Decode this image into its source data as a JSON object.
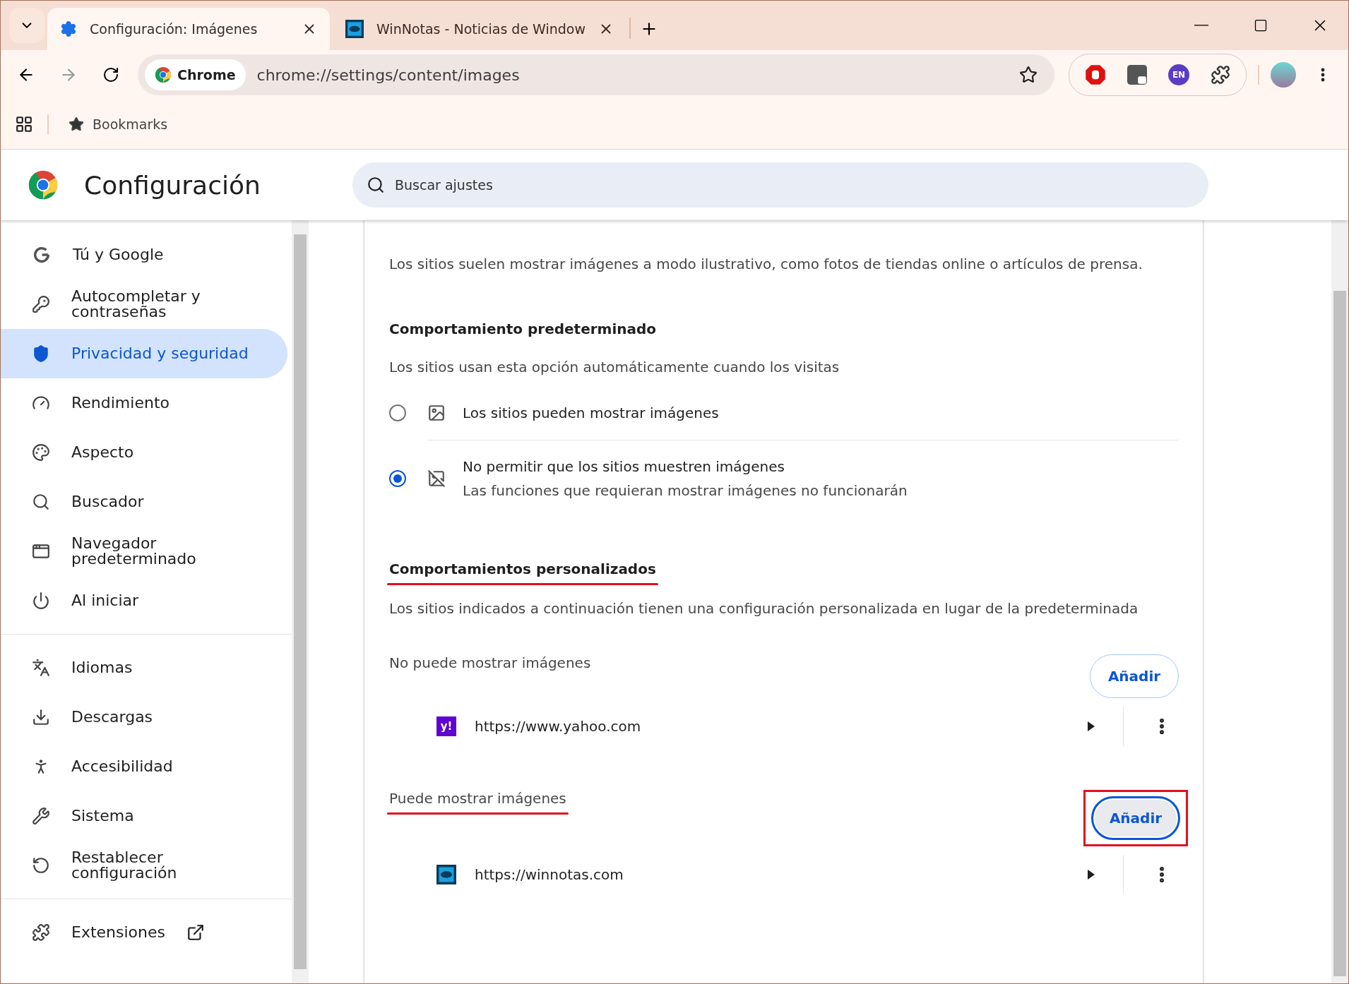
{
  "tabs": [
    {
      "title": "Configuración: Imágenes",
      "selected": true
    },
    {
      "title": "WinNotas - Noticias de Window",
      "selected": false
    }
  ],
  "address_bar": {
    "chip": "Chrome",
    "url": "chrome://settings/content/images"
  },
  "extensions": [
    {
      "kind": "stop"
    },
    {
      "kind": "camera"
    },
    {
      "kind": "badge",
      "label": "EN"
    },
    {
      "kind": "puzzle"
    }
  ],
  "bookmarks_bar": {
    "label": "Bookmarks"
  },
  "settings": {
    "title": "Configuración",
    "search_placeholder": "Buscar ajustes"
  },
  "sidebar": {
    "groups": [
      [
        {
          "label": "Tú y Google",
          "selected": false
        },
        {
          "label": "Autocompletar y contraseñas",
          "selected": false
        },
        {
          "label": "Privacidad y seguridad",
          "selected": true
        },
        {
          "label": "Rendimiento",
          "selected": false
        },
        {
          "label": "Aspecto",
          "selected": false
        },
        {
          "label": "Buscador",
          "selected": false
        },
        {
          "label": "Navegador predeterminado",
          "selected": false
        },
        {
          "label": "Al iniciar",
          "selected": false
        }
      ],
      [
        {
          "label": "Idiomas",
          "selected": false
        },
        {
          "label": "Descargas",
          "selected": false
        },
        {
          "label": "Accesibilidad",
          "selected": false
        },
        {
          "label": "Sistema",
          "selected": false
        },
        {
          "label": "Restablecer configuración",
          "selected": false
        }
      ],
      [
        {
          "label": "Extensiones",
          "selected": false
        }
      ]
    ]
  },
  "content": {
    "intro": "Los sitios suelen mostrar imágenes a modo ilustrativo, como fotos de tiendas online o artículos de prensa.",
    "default_heading": "Comportamiento predeterminado",
    "default_subtitle": "Los sitios usan esta opción automáticamente cuando los visitas",
    "options": [
      {
        "label": "Los sitios pueden mostrar imágenes",
        "selected": false
      },
      {
        "label": "No permitir que los sitios muestren imágenes",
        "sublabel": "Las funciones que requieran mostrar imágenes no funcionarán",
        "selected": true
      }
    ],
    "custom_heading": {
      "text": "Comportamientos personalizados",
      "marked": true
    },
    "custom_description": "Los sitios indicados a continuación tienen una configuración personalizada en lugar de la predeterminada",
    "lists": [
      {
        "title": "No puede mostrar imágenes",
        "marked": false,
        "button": {
          "label": "Añadir",
          "focused": false,
          "marked": false
        },
        "sites": [
          {
            "url": "https://www.yahoo.com",
            "favicon_label": "y!"
          }
        ]
      },
      {
        "title": "Puede mostrar imágenes",
        "marked": true,
        "button": {
          "label": "Añadir",
          "focused": true,
          "marked": true
        },
        "sites": [
          {
            "url": "https://winnotas.com"
          }
        ]
      }
    ]
  }
}
